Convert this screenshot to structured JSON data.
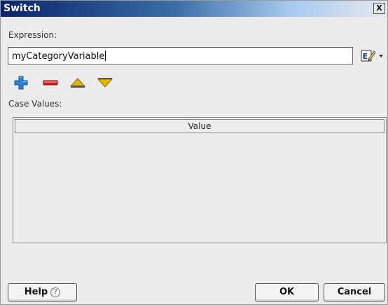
{
  "window": {
    "title": "Switch",
    "close_label": "X"
  },
  "expression": {
    "label": "Expression:",
    "value": "myCategoryVariable"
  },
  "toolbar": {
    "icons": [
      "add-icon",
      "remove-icon",
      "move-up-icon",
      "move-down-icon"
    ]
  },
  "case_values": {
    "label": "Case Values:",
    "columns": [
      "Value"
    ],
    "rows": []
  },
  "buttons": {
    "help": "Help",
    "help_glyph": "?",
    "ok": "OK",
    "cancel": "Cancel"
  },
  "colors": {
    "title_bar_start": "#0a246a",
    "add": "#2e7fd6",
    "remove": "#cc1a1a",
    "arrows": "#e0b800"
  }
}
